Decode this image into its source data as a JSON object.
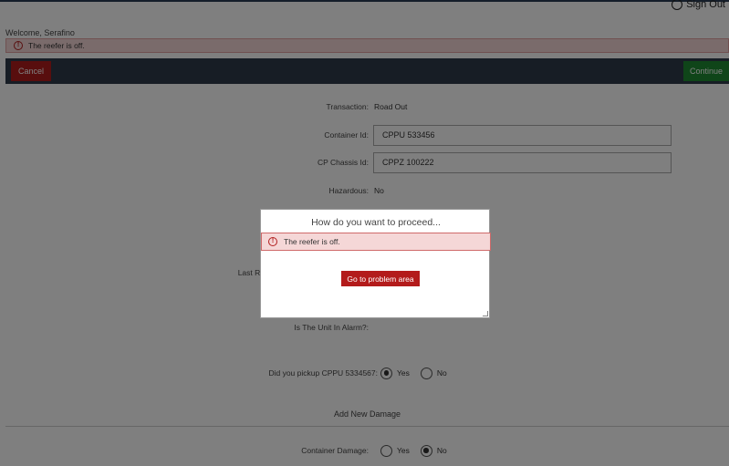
{
  "header": {
    "sign_out": "Sign Out",
    "welcome": "Welcome, Serafino"
  },
  "alert": {
    "message": "The reefer is off."
  },
  "actions": {
    "cancel": "Cancel",
    "continue": "Continue"
  },
  "form": {
    "transaction_label": "Transaction:",
    "transaction_value": "Road Out",
    "container_id_label": "Container Id:",
    "container_id_value": "CPPU 533456",
    "chassis_id_label": "CP Chassis Id:",
    "chassis_id_value": "CPPZ 100222",
    "hazardous_label": "Hazardous:",
    "hazardous_value": "No",
    "last_re_label": "Last Re",
    "alarm_label": "Is The Unit In Alarm?:",
    "pickup_label": "Did you pickup CPPU 5334567:",
    "pickup_yes": "Yes",
    "pickup_no": "No",
    "add_damage_title": "Add New Damage",
    "container_damage_label": "Container Damage:",
    "damage_yes": "Yes",
    "damage_no": "No"
  },
  "modal": {
    "title": "How do you want to proceed...",
    "alert": "The reefer is off.",
    "button": "Go to problem area"
  },
  "colors": {
    "alert_bg": "#f5d7d7",
    "danger": "#b11c1c",
    "success": "#1f8a33",
    "actionbar": "#2e3b4a"
  }
}
